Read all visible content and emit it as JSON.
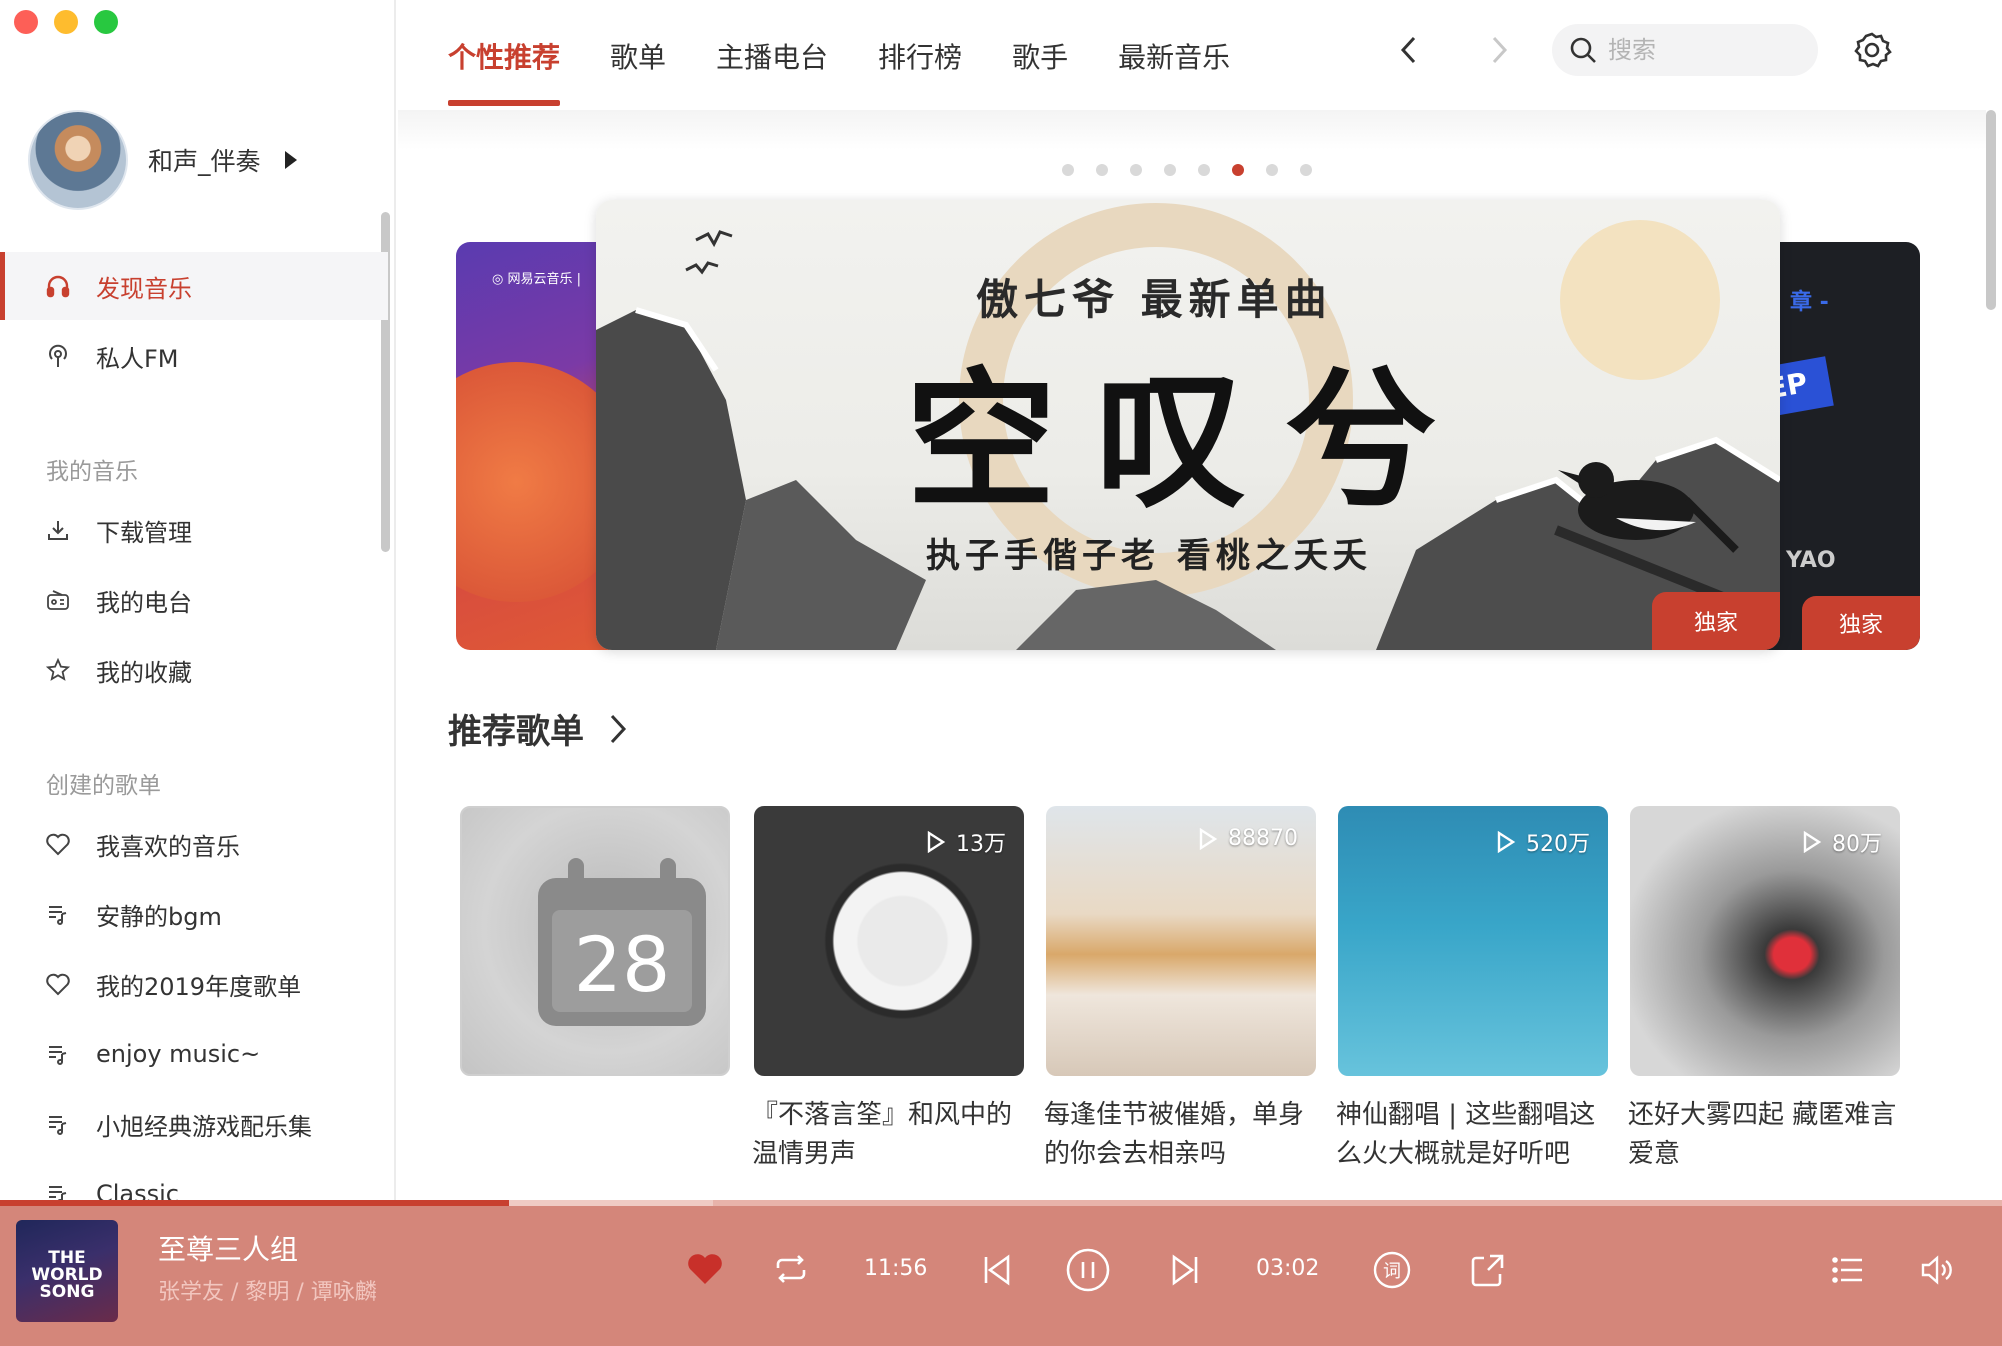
{
  "user": {
    "name": "和声_伴奏"
  },
  "sidebar": {
    "primary": [
      {
        "label": "发现音乐",
        "icon": "headphones-icon",
        "active": true
      },
      {
        "label": "私人FM",
        "icon": "podcast-icon",
        "active": false
      }
    ],
    "my_music_title": "我的音乐",
    "my_music": [
      {
        "label": "下载管理",
        "icon": "download-icon"
      },
      {
        "label": "我的电台",
        "icon": "radio-icon"
      },
      {
        "label": "我的收藏",
        "icon": "star-icon"
      }
    ],
    "created_title": "创建的歌单",
    "created": [
      {
        "label": "我喜欢的音乐",
        "icon": "heart-icon"
      },
      {
        "label": "安静的bgm",
        "icon": "playlist-icon"
      },
      {
        "label": "我的2019年度歌单",
        "icon": "heart-icon"
      },
      {
        "label": "enjoy music~",
        "icon": "playlist-icon"
      },
      {
        "label": "小旭经典游戏配乐集",
        "icon": "playlist-icon"
      },
      {
        "label": "Classic",
        "icon": "playlist-icon"
      }
    ]
  },
  "tabs": [
    "个性推荐",
    "歌单",
    "主播电台",
    "排行榜",
    "歌手",
    "最新音乐"
  ],
  "active_tab": 0,
  "search": {
    "placeholder": "搜索"
  },
  "banner": {
    "dot_count": 8,
    "active_dot": 5,
    "subtitle": "傲七爷  最新单曲",
    "title": "空叹兮",
    "line": "执子手偕子老  看桃之夭夭",
    "badge": "独家",
    "left_tagline": "◎ 网易云音乐 |",
    "right_ep": "EP",
    "right_yao": "YAO",
    "right_zhang": "章 -",
    "right_badge": "独家"
  },
  "recommended": {
    "title": "推荐歌单",
    "daily_day": "28",
    "cards": [
      {
        "plays": "",
        "label": ""
      },
      {
        "plays": "13万",
        "label": "『不落言筌』和风中的温情男声"
      },
      {
        "plays": "88870",
        "label": "每逢佳节被催婚，单身的你会去相亲吗"
      },
      {
        "plays": "520万",
        "label": "神仙翻唱 | 这些翻唱这么火大概就是好听吧"
      },
      {
        "plays": "80万",
        "label": "还好大雾四起 藏匿难言爱意"
      }
    ]
  },
  "player": {
    "cover_text": "THE WORLD SONG",
    "song": "至尊三人组",
    "artists": "张学友 / 黎明 / 谭咏麟",
    "elapsed": "11:56",
    "duration": "03:02",
    "progress": 0.254,
    "buffered": 0.356
  },
  "colors": {
    "accent": "#c8402f",
    "player_bg": "#d4867a"
  }
}
